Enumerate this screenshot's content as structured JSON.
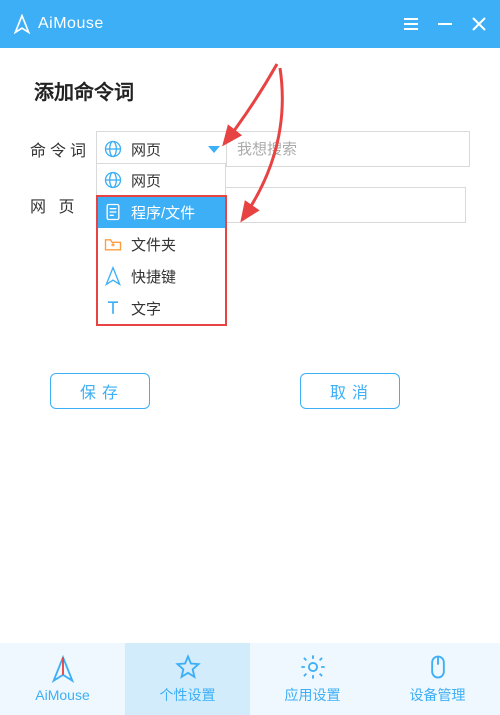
{
  "header": {
    "app_name": "AiMouse"
  },
  "title": "添加命令词",
  "form": {
    "command_label": "命令词",
    "web_label": "网 页",
    "selected_type": "网页",
    "search_placeholder": "我想搜索",
    "web_value": ""
  },
  "dropdown": {
    "items": [
      {
        "label": "网页",
        "icon": "web"
      },
      {
        "label": "程序/文件",
        "icon": "file",
        "selected": true
      },
      {
        "label": "文件夹",
        "icon": "folder"
      },
      {
        "label": "快捷键",
        "icon": "shortcut"
      },
      {
        "label": "文字",
        "icon": "text"
      }
    ]
  },
  "buttons": {
    "save": "保存",
    "cancel": "取消"
  },
  "tabs": [
    {
      "label": "AiMouse",
      "icon": "logo"
    },
    {
      "label": "个性设置",
      "icon": "star",
      "active": true
    },
    {
      "label": "应用设置",
      "icon": "gear"
    },
    {
      "label": "设备管理",
      "icon": "mouse"
    }
  ],
  "colors": {
    "accent": "#3daff6",
    "highlight": "#e84343"
  }
}
